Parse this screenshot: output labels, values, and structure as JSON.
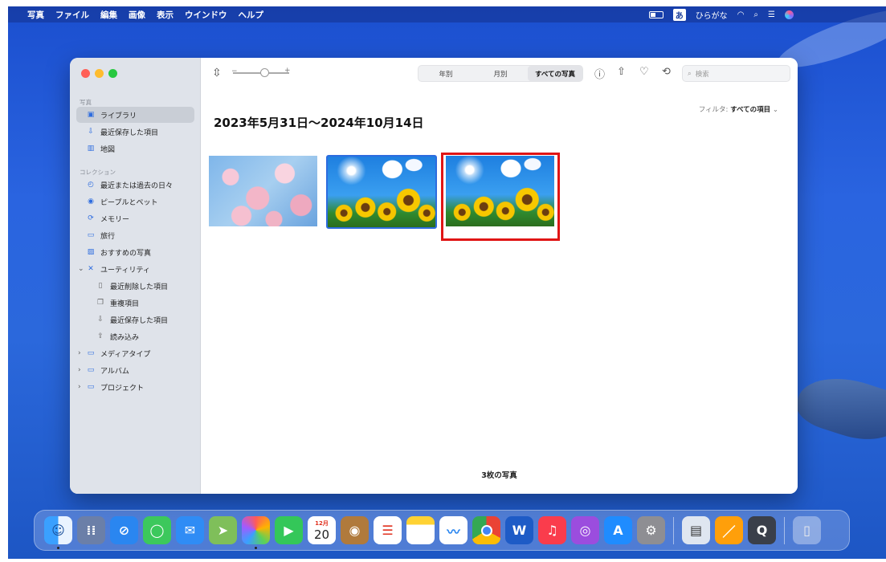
{
  "menubar": {
    "apple_icon": "apple-icon",
    "items": [
      "写真",
      "ファイル",
      "編集",
      "画像",
      "表示",
      "ウインドウ",
      "ヘルプ"
    ],
    "ime_label": "あ",
    "ime_mode": "ひらがな"
  },
  "sidebar": {
    "section_photos": "写真",
    "library": "ライブラリ",
    "recently_saved": "最近保存した項目",
    "map": "地図",
    "section_collections": "コレクション",
    "recent_days": "最近または過去の日々",
    "people_pets": "ピープルとペット",
    "memories": "メモリー",
    "trips": "旅行",
    "featured": "おすすめの写真",
    "utilities": "ユーティリティ",
    "recently_deleted": "最近削除した項目",
    "duplicates": "重複項目",
    "recently_saved_2": "最近保存した項目",
    "imports": "読み込み",
    "media_types": "メディアタイプ",
    "albums": "アルバム",
    "projects": "プロジェクト"
  },
  "toolbar": {
    "slider_minus": "−",
    "slider_plus": "+",
    "segments": [
      "年別",
      "月別",
      "すべての写真"
    ],
    "active_segment": "すべての写真",
    "search_placeholder": "検索"
  },
  "main": {
    "filter_label": "フィルタ:",
    "filter_value": "すべての項目",
    "date_range": "2023年5月31日〜2024年10月14日",
    "photo_count": "3枚の写真",
    "photos": [
      "cherry-blossom",
      "sunflowers",
      "sunflowers"
    ]
  },
  "dock": {
    "calendar_month": "12月",
    "calendar_day": "20"
  },
  "colors": {
    "accent": "#2d6cdf",
    "highlight": "#e01515"
  }
}
